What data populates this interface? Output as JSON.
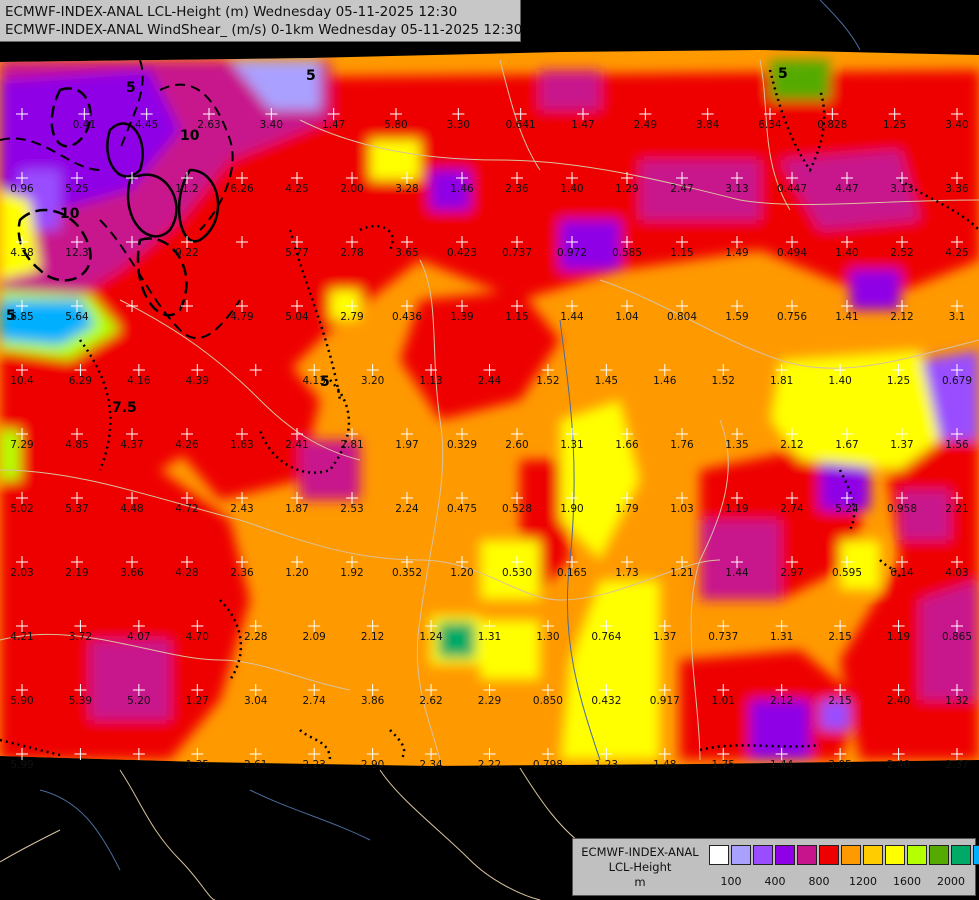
{
  "header": {
    "line1": "ECMWF-INDEX-ANAL LCL-Height (m) Wednesday 05-11-2025 12:30",
    "line2": "ECMWF-INDEX-ANAL WindShear_ (m/s) 0-1km Wednesday 05-11-2025 12:30"
  },
  "legend": {
    "line1": "ECMWF-INDEX-ANAL",
    "line2": "LCL-Height",
    "line3": "m",
    "colors": [
      "#ffffff",
      "#aaa0ff",
      "#9a4dff",
      "#8f00e6",
      "#c8148c",
      "#ee0000",
      "#ff9900",
      "#ffcc00",
      "#ffff00",
      "#b4ff00",
      "#55aa00",
      "#00aa66",
      "#00b0ff"
    ],
    "ticks": [
      "100",
      "400",
      "800",
      "1200",
      "1600",
      "2000"
    ]
  },
  "contour_labels": [
    "5",
    "5",
    "10",
    "10",
    "5",
    "7.5",
    "5",
    "5"
  ],
  "values": {
    "row1": [
      "",
      "0.41",
      "4.45",
      "2.63",
      "3.40",
      "1.47",
      "5.80",
      "3.30",
      "0.641",
      "1.47",
      "2.49",
      "3.84",
      "6.34",
      "0.828",
      "1.25",
      "3.40"
    ],
    "row2": [
      "0.96",
      "5.25",
      "",
      "11.2",
      "6.26",
      "4.25",
      "2.00",
      "3.28",
      "1.46",
      "2.36",
      "1.40",
      "1.29",
      "2.47",
      "3.13",
      "0.447",
      "4.47",
      "3.13",
      "3.36"
    ],
    "row3": [
      "4.38",
      "12.3",
      "",
      "9.22",
      "",
      "5.77",
      "2.78",
      "3.65",
      "0.423",
      "0.737",
      "0.972",
      "0.585",
      "1.15",
      "1.49",
      "0.494",
      "1.40",
      "2.52",
      "4.25"
    ],
    "row4": [
      "6.85",
      "5.64",
      "",
      "",
      "4.79",
      "5.04",
      "2.79",
      "0.436",
      "1.39",
      "1.15",
      "1.44",
      "1.04",
      "0.804",
      "1.59",
      "0.756",
      "1.41",
      "2.12",
      "3.1"
    ],
    "row5": [
      "10.4",
      "6.29",
      "4.16",
      "4.39",
      "",
      "4.13",
      "3.20",
      "1.13",
      "2.44",
      "1.52",
      "1.45",
      "1.46",
      "1.52",
      "1.81",
      "1.40",
      "1.25",
      "0.679"
    ],
    "row6": [
      "7.29",
      "4.85",
      "4.37",
      "4.26",
      "1.63",
      "2.41",
      "2.81",
      "1.97",
      "0.329",
      "2.60",
      "1.31",
      "1.66",
      "1.76",
      "1.35",
      "2.12",
      "1.67",
      "1.37",
      "1.56"
    ],
    "row7": [
      "5.02",
      "5.37",
      "4.48",
      "4.72",
      "2.43",
      "1.87",
      "2.53",
      "2.24",
      "0.475",
      "0.528",
      "1.90",
      "1.79",
      "1.03",
      "1.19",
      "2.74",
      "5.24",
      "0.958",
      "2.21"
    ],
    "row8": [
      "2.03",
      "2.19",
      "3.66",
      "4.28",
      "2.36",
      "1.20",
      "1.92",
      "0.352",
      "1.20",
      "0.530",
      "0.165",
      "1.73",
      "1.21",
      "1.44",
      "2.97",
      "0.595",
      "6.14",
      "4.03"
    ],
    "row9": [
      "4.21",
      "3.72",
      "4.07",
      "4.70",
      "2.28",
      "2.09",
      "2.12",
      "1.24",
      "1.31",
      "1.30",
      "0.764",
      "1.37",
      "0.737",
      "1.31",
      "2.15",
      "1.19",
      "0.865"
    ],
    "row10": [
      "5.90",
      "5.39",
      "5.20",
      "1.27",
      "3.04",
      "2.74",
      "3.86",
      "2.62",
      "2.29",
      "0.850",
      "0.432",
      "0.917",
      "1.01",
      "2.12",
      "2.15",
      "2.40",
      "1.32"
    ],
    "row11": [
      "5.99",
      "",
      "",
      "1.35",
      "2.61",
      "2.23",
      "2.90",
      "2.34",
      "2.22",
      "0.798",
      "1.23",
      "1.48",
      "1.75",
      "1.44",
      "3.05",
      "2.40",
      "2.37"
    ]
  }
}
